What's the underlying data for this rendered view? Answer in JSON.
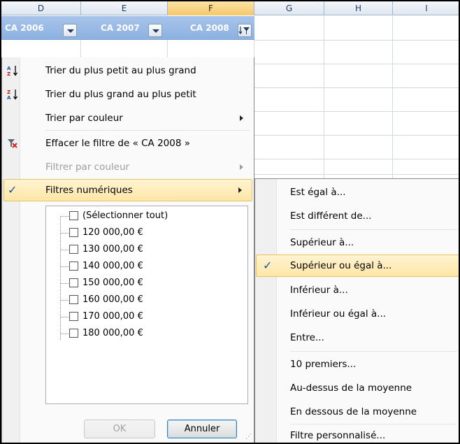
{
  "columns": [
    "D",
    "E",
    "F",
    "G",
    "H",
    "I"
  ],
  "table_headers": [
    "CA 2006",
    "CA 2007",
    "CA 2008"
  ],
  "menu": {
    "sort_asc": "Trier du plus petit au plus grand",
    "sort_desc": "Trier du plus grand au plus petit",
    "sort_color": "Trier par couleur",
    "clear_filter": "Effacer le filtre de « CA 2008 »",
    "filter_color": "Filtrer par couleur",
    "number_filters": "Filtres numériques"
  },
  "list": {
    "select_all": "(Sélectionner tout)",
    "values": [
      "120 000,00 €",
      "130 000,00 €",
      "140 000,00 €",
      "150 000,00 €",
      "160 000,00 €",
      "170 000,00 €",
      "180 000,00 €"
    ]
  },
  "buttons": {
    "ok": "OK",
    "cancel": "Annuler"
  },
  "submenu": [
    "Est égal à...",
    "Est différent de...",
    "Supérieur à...",
    "Supérieur ou égal à...",
    "Inférieur à...",
    "Inférieur ou égal à...",
    "Entre...",
    "10 premiers...",
    "Au-dessus de la moyenne",
    "En dessous de la moyenne",
    "Filtre personnalisé..."
  ],
  "icons": {
    "sort_asc": "sort-ascending-icon",
    "sort_desc": "sort-descending-icon",
    "clear_filter": "clear-filter-icon",
    "check": "checkmark-icon",
    "filter": "filter-icon"
  },
  "colors": {
    "header_blue": "#8db1e0",
    "highlight": "#fde6a5",
    "selected_column": "#f5c76b"
  }
}
